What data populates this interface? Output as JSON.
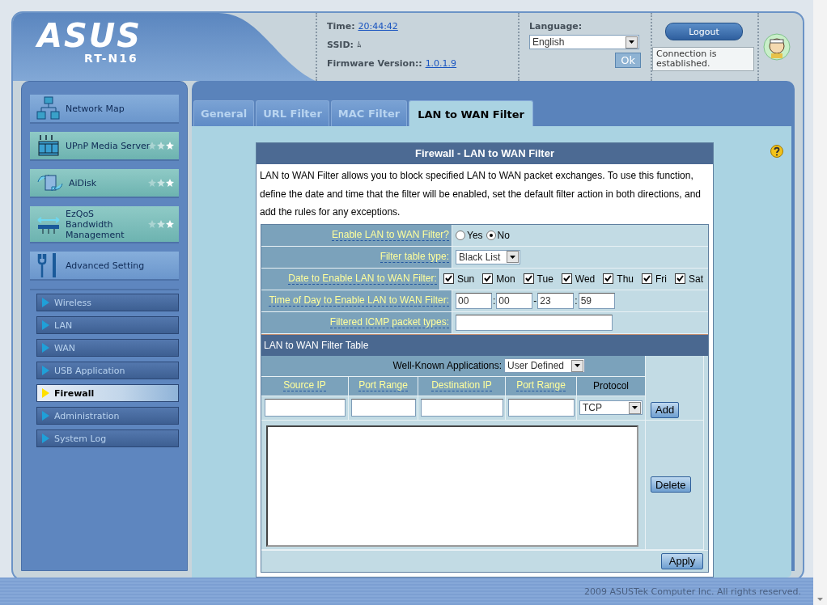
{
  "header": {
    "logo": "ASUS",
    "model": "RT-N16",
    "time_label": "Time:",
    "time": "20:44:42",
    "ssid_label": "SSID:",
    "ssid": "ﾑ",
    "firmware_label": "Firmware Version::",
    "firmware": "1.0.1.9",
    "language_label": "Language:",
    "language": "English",
    "ok_button": "Ok",
    "logout_button": "Logout",
    "tooltip": "Connection is established."
  },
  "sidebar": {
    "items": [
      {
        "label": "Network Map",
        "kind": "network",
        "highlight": false
      },
      {
        "label": "UPnP Media Server",
        "kind": "media",
        "highlight": true
      },
      {
        "label": "AiDisk",
        "kind": "disk",
        "highlight": true
      },
      {
        "label": "EzQoS Bandwidth Management",
        "kind": "qos",
        "highlight": true
      },
      {
        "label": "Advanced Setting",
        "kind": "tools",
        "highlight": false
      }
    ],
    "submenu": [
      {
        "label": "Wireless",
        "selected": false
      },
      {
        "label": "LAN",
        "selected": false
      },
      {
        "label": "WAN",
        "selected": false
      },
      {
        "label": "USB Application",
        "selected": false
      },
      {
        "label": "Firewall",
        "selected": true
      },
      {
        "label": "Administration",
        "selected": false
      },
      {
        "label": "System Log",
        "selected": false
      }
    ]
  },
  "tabs": [
    {
      "label": "General",
      "selected": false
    },
    {
      "label": "URL Filter",
      "selected": false
    },
    {
      "label": "MAC Filter",
      "selected": false
    },
    {
      "label": "LAN to WAN Filter",
      "selected": true
    }
  ],
  "panel": {
    "title": "Firewall - LAN to WAN Filter",
    "description": "LAN to WAN Filter allows you to block specified LAN to WAN packet exchanges. To use this function, define the date and time that the filter will be enabled, set the default filter action in both directions, and add the rules for any exceptions.",
    "enable": {
      "label": "Enable LAN to WAN Filter?",
      "options": [
        {
          "label": "Yes",
          "selected": false
        },
        {
          "label": "No",
          "selected": true
        }
      ]
    },
    "filter_type": {
      "label": "Filter table type:",
      "value": "Black List"
    },
    "days": {
      "label": "Date to Enable LAN to WAN Filter:",
      "items": [
        {
          "label": "Sun",
          "checked": true
        },
        {
          "label": "Mon",
          "checked": true
        },
        {
          "label": "Tue",
          "checked": true
        },
        {
          "label": "Wed",
          "checked": true
        },
        {
          "label": "Thu",
          "checked": true
        },
        {
          "label": "Fri",
          "checked": true
        },
        {
          "label": "Sat",
          "checked": true
        }
      ]
    },
    "time": {
      "label": "Time of Day to Enable LAN to WAN Filter:",
      "values": [
        "00",
        "00",
        "23",
        "59"
      ],
      "separators": [
        ":",
        "-",
        ":"
      ]
    },
    "icmp": {
      "label": "Filtered ICMP packet types:"
    },
    "table": {
      "title": "LAN to WAN Filter Table",
      "well_known_label": "Well-Known Applications:",
      "well_known_value": "User Defined",
      "columns": [
        {
          "label": "Source IP",
          "kind": "link"
        },
        {
          "label": "Port Range",
          "kind": "link"
        },
        {
          "label": "Destination IP",
          "kind": "link"
        },
        {
          "label": "Port Range",
          "kind": "link"
        },
        {
          "label": "Protocol",
          "kind": "plain"
        }
      ],
      "protocol": "TCP",
      "add_button": "Add",
      "delete_button": "Delete",
      "apply_button": "Apply"
    }
  },
  "footer": {
    "copyright": "2009 ASUSTek Computer Inc. All rights reserved."
  }
}
